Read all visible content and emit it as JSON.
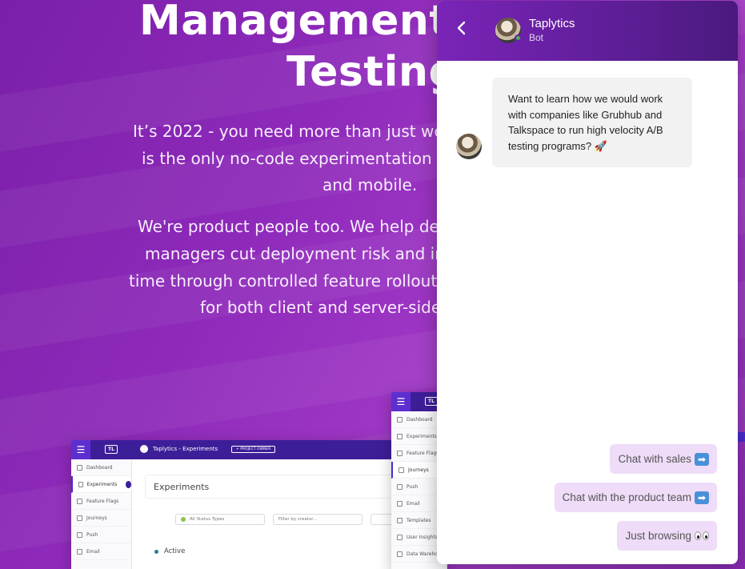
{
  "hero": {
    "heading_line1": "Management (",
    "heading_line2": "Testing",
    "para1": [
      "It’s 2022 - you need more than just web",
      "is the only no-code experimentation s",
      "and mobile."
    ],
    "para2": [
      "We're product people too. We help dev",
      "managers cut deployment risk and im",
      "time through controlled feature rollouts",
      "for both client and server-side"
    ]
  },
  "mockup_main": {
    "logo": "TL",
    "project": "Taplytics - Experiments",
    "project_owner_btn": "+ PROJECT OWNER",
    "sidebar": [
      "Dashboard",
      "Experiments",
      "Feature Flags",
      "Journeys",
      "Push",
      "Email"
    ],
    "page_title": "Experiments",
    "filter_status": "All Status Types",
    "filter_creator": "Filter by creator...",
    "section_active": "Active"
  },
  "mockup_side": {
    "logo": "TL",
    "sidebar": [
      "Dashboard",
      "Experiments",
      "Feature Flags",
      "Journeys",
      "Push",
      "Email",
      "Templates",
      "User Insights",
      "Data Wareho"
    ]
  },
  "chat": {
    "bot_name": "Taplytics",
    "bot_role": "Bot",
    "message_lines": [
      "Want to learn how we would work",
      "with companies like Grubhub and",
      "Talkspace to run high velocity A/B",
      "testing programs? 🚀"
    ],
    "quick_replies": [
      "Chat with sales",
      "Chat with the product team",
      "Just browsing"
    ],
    "colors": {
      "header": "#6a21a8",
      "quick_reply_bg": "#eedcf8",
      "bubble_bg": "#f2f2f2"
    }
  }
}
